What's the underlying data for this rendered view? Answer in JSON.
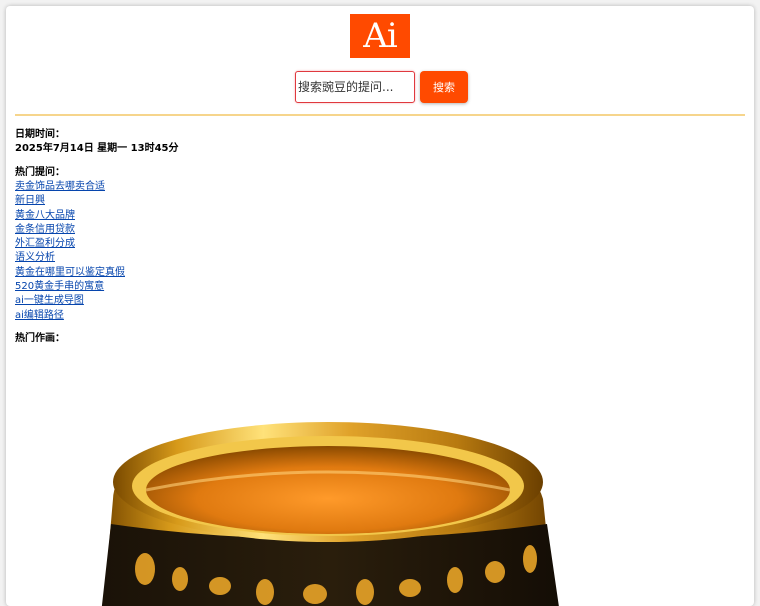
{
  "logo": {
    "text": "Ai"
  },
  "search": {
    "placeholder": "搜索豌豆的提问...",
    "button_label": "搜索"
  },
  "date": {
    "label": "日期时间：",
    "value": "2025年7月14日 星期一 13时45分"
  },
  "hot_questions": {
    "label": "热门提问：",
    "items": [
      "卖金饰品去哪卖合适",
      "新日興",
      "黄金八大品牌",
      "金条信用贷款",
      "外汇盈利分成",
      "语义分析",
      "黄金在哪里可以鉴定真假",
      "520黄金手串的寓意",
      "ai一键生成导图",
      "ai编辑路径"
    ]
  },
  "hot_paintings": {
    "label": "热门作画："
  },
  "colors": {
    "accent": "#ff4a00",
    "divider": "#f6d58c",
    "link": "#0645ad"
  },
  "image": {
    "subject": "gold ring"
  }
}
